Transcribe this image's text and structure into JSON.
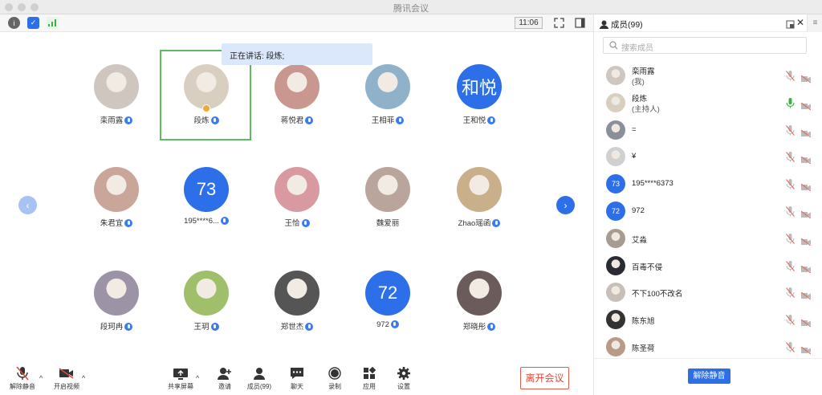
{
  "window": {
    "title": "腾讯会议"
  },
  "top_bar": {
    "time": "11:06"
  },
  "speaking": {
    "text": "正在讲话: 段炼;"
  },
  "grid": [
    {
      "name": "栾雨露",
      "avatar": "photo",
      "color": "#cfc6c0"
    },
    {
      "name": "段炼",
      "avatar": "photo",
      "color": "#d8cfc1",
      "host": true
    },
    {
      "name": "蒋悦君",
      "avatar": "photo",
      "color": "#c9978f"
    },
    {
      "name": "王相菲",
      "avatar": "photo",
      "color": "#8fb1c9"
    },
    {
      "name": "王和悦",
      "avatar": "text",
      "initials": "和悦"
    },
    {
      "name": "朱君宜",
      "avatar": "photo",
      "color": "#c9a59a"
    },
    {
      "name": "195****6...",
      "avatar": "text",
      "initials": "73"
    },
    {
      "name": "王恰",
      "avatar": "photo",
      "color": "#d89aa0"
    },
    {
      "name": "魏爱丽",
      "avatar": "photo",
      "color": "#b9a59c",
      "no_mic": true
    },
    {
      "name": "Zhao瑶函",
      "avatar": "photo",
      "color": "#c9b08a"
    },
    {
      "name": "段珂冉",
      "avatar": "photo",
      "color": "#9d93a7"
    },
    {
      "name": "王玥",
      "avatar": "photo",
      "color": "#9fbf6a"
    },
    {
      "name": "郑世杰",
      "avatar": "photo",
      "color": "#555555"
    },
    {
      "name": "972",
      "avatar": "text",
      "initials": "72"
    },
    {
      "name": "郑晓彤",
      "avatar": "photo",
      "color": "#6b5b5b"
    }
  ],
  "bottom_bar": {
    "unmute": "解除静音",
    "video": "开启视频",
    "share": "共享屏幕",
    "invite": "邀请",
    "members": "成员(99)",
    "chat": "聊天",
    "record": "录制",
    "apps": "应用",
    "settings": "设置",
    "leave": "离开会议"
  },
  "panel": {
    "title": "成员(99)",
    "search_placeholder": "搜索成员",
    "unmute_all": "解除静音",
    "members": [
      {
        "name": "栾雨露",
        "sub": "(我)",
        "avatar": "photo",
        "color": "#cfc6c0"
      },
      {
        "name": "段炼",
        "sub": "(主持人)",
        "avatar": "photo",
        "color": "#d8cfc1",
        "mic_on": true
      },
      {
        "name": "=",
        "sub": "",
        "avatar": "photo",
        "color": "#8a8f99"
      },
      {
        "name": "¥",
        "sub": "",
        "avatar": "photo",
        "color": "#d0d0d0"
      },
      {
        "name": "195****6373",
        "sub": "",
        "avatar": "text",
        "initials": "73"
      },
      {
        "name": "972",
        "sub": "",
        "avatar": "text",
        "initials": "72"
      },
      {
        "name": "艾淼",
        "sub": "",
        "avatar": "photo",
        "color": "#a89c90"
      },
      {
        "name": "百毒不侵",
        "sub": "",
        "avatar": "photo",
        "color": "#2b2b33"
      },
      {
        "name": "不下100不改名",
        "sub": "",
        "avatar": "photo",
        "color": "#c8bfb8"
      },
      {
        "name": "陈东旭",
        "sub": "",
        "avatar": "photo",
        "color": "#333333"
      },
      {
        "name": "陈圣荷",
        "sub": "",
        "avatar": "photo",
        "color": "#b89a86"
      }
    ]
  }
}
